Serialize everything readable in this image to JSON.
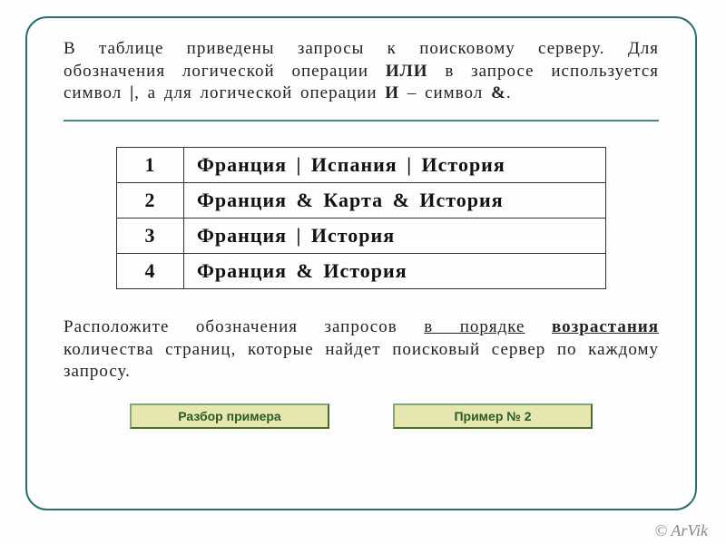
{
  "intro": {
    "t1": "В таблице приведены запросы к поисковому серверу. Для обозначения логической операции ",
    "b1": "ИЛИ",
    "t2": " в запросе используется символ ",
    "b2": "|",
    "t3": ", а для логической операции ",
    "b3": "И",
    "t4": " – символ ",
    "b4": "&",
    "t5": "."
  },
  "rows": [
    {
      "n": "1",
      "q": "Франция | Испания | История"
    },
    {
      "n": "2",
      "q": "Франция & Карта & История"
    },
    {
      "n": "3",
      "q": "Франция | История"
    },
    {
      "n": "4",
      "q": "Франция & История"
    }
  ],
  "instruction": {
    "t1": "Расположите обозначения запросов ",
    "u1": "в порядке",
    "sp": " ",
    "u2": "возрастания",
    "t2": " количества страниц, которые найдет поисковый сервер по каждому запросу."
  },
  "buttons": {
    "b1": "Разбор примера",
    "b2": "Пример № 2"
  },
  "copyright": "© ArVik"
}
